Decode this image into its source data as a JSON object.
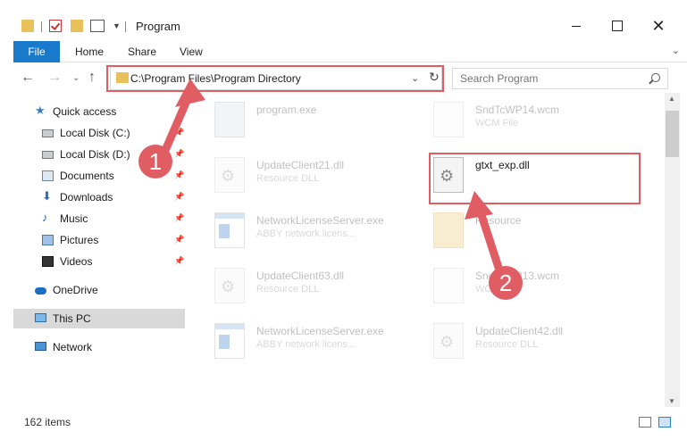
{
  "window": {
    "title": "Program",
    "close_glyph": "✕"
  },
  "ribbon": {
    "file": "File",
    "home": "Home",
    "share": "Share",
    "view": "View"
  },
  "address": {
    "path": "C:\\Program Files\\Program Directory"
  },
  "search": {
    "placeholder": "Search Program"
  },
  "sidebar": {
    "items": [
      {
        "label": "Quick access",
        "icon": "star-icon"
      },
      {
        "label": "Local Disk (C:)",
        "icon": "disk-icon",
        "pinned": true
      },
      {
        "label": "Local Disk (D:)",
        "icon": "disk-icon",
        "pinned": true
      },
      {
        "label": "Documents",
        "icon": "documents-icon",
        "pinned": true
      },
      {
        "label": "Downloads",
        "icon": "download-icon",
        "pinned": true
      },
      {
        "label": "Music",
        "icon": "music-icon",
        "pinned": true
      },
      {
        "label": "Pictures",
        "icon": "pictures-icon",
        "pinned": true
      },
      {
        "label": "Videos",
        "icon": "videos-icon",
        "pinned": true
      },
      {
        "label": "OneDrive",
        "icon": "cloud-icon"
      },
      {
        "label": "This PC",
        "icon": "pc-icon",
        "selected": true
      },
      {
        "label": "Network",
        "icon": "network-icon"
      }
    ]
  },
  "files": [
    {
      "name": "program.exe",
      "type": "",
      "icon": "exe-icon"
    },
    {
      "name": "SndTcWP14.wcm",
      "type": "WCM File",
      "icon": "wcm-icon"
    },
    {
      "name": "UpdateClient21.dll",
      "type": "Resource DLL",
      "icon": "dll-icon"
    },
    {
      "name": "gtxt_exp.dll",
      "type": "",
      "icon": "dll-icon",
      "highlighted": true
    },
    {
      "name": "NetworkLicenseServer.exe",
      "type": "ABBY network licens...",
      "icon": "app-icon"
    },
    {
      "name": "Resource",
      "type": "",
      "icon": "folder-icon"
    },
    {
      "name": "UpdateClient63.dll",
      "type": "Resource DLL",
      "icon": "dll-icon"
    },
    {
      "name": "SndTcWP13.wcm",
      "type": "WCM File",
      "icon": "wcm-icon"
    },
    {
      "name": "NetworkLicenseServer.exe",
      "type": "ABBY network licens...",
      "icon": "app-icon"
    },
    {
      "name": "UpdateClient42.dll",
      "type": "Resource DLL",
      "icon": "dll-icon"
    }
  ],
  "annotations": {
    "step1": "1",
    "step2": "2",
    "color": "#e05d63"
  },
  "status": {
    "count": "162 items"
  },
  "colors": {
    "accent": "#1979ca",
    "highlight": "#e05d63"
  }
}
